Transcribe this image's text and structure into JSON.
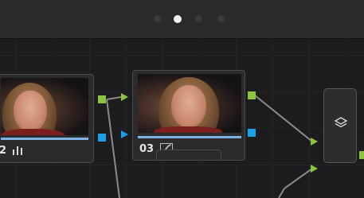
{
  "pagination": {
    "pages": 4,
    "active_index": 1
  },
  "nodes": [
    {
      "id": "left",
      "label": "2",
      "icon": "rgb-mixer-icon"
    },
    {
      "id": "center",
      "label": "03",
      "icon": "curves-icon"
    }
  ],
  "layer_node": {
    "icon": "layer-mixer-icon"
  },
  "colors": {
    "rgb_port": "#8bc53f",
    "alpha_port": "#18a0e8",
    "accent_bar": "#7fb3e6"
  }
}
